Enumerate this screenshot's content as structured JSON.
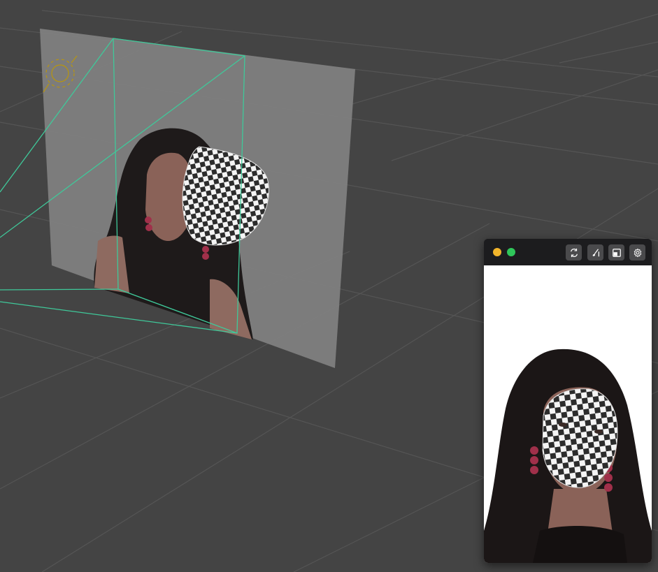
{
  "scene": {
    "background_color": "#444444",
    "grid_color": "#555555",
    "frustum_color": "#3fc99a",
    "light_gizmo_color": "#b8960e",
    "image_plane_color": "#7f7f7f"
  },
  "preview_window": {
    "traffic_lights": [
      {
        "name": "minimize",
        "color": "#f2b52b"
      },
      {
        "name": "zoom",
        "color": "#2fc65a"
      }
    ],
    "toolbar": [
      {
        "name": "refresh",
        "icon": "refresh-icon"
      },
      {
        "name": "edit",
        "icon": "brush-icon"
      },
      {
        "name": "layout",
        "icon": "layout-icon"
      },
      {
        "name": "settings",
        "icon": "gear-icon"
      }
    ]
  }
}
